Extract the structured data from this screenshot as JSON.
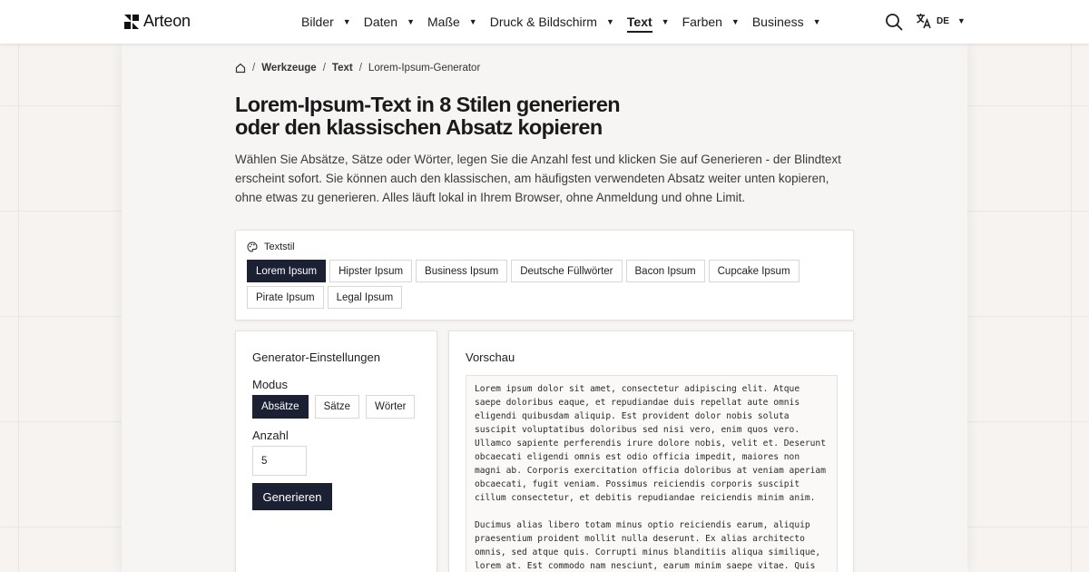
{
  "brand": {
    "name": "Arteon"
  },
  "nav": {
    "items": [
      {
        "label": "Bilder",
        "active": false
      },
      {
        "label": "Daten",
        "active": false
      },
      {
        "label": "Maße",
        "active": false
      },
      {
        "label": "Druck & Bildschirm",
        "active": false
      },
      {
        "label": "Text",
        "active": true
      },
      {
        "label": "Farben",
        "active": false
      },
      {
        "label": "Business",
        "active": false
      }
    ],
    "search_icon": "search-icon",
    "language": {
      "icon": "translate-icon",
      "code": "DE"
    }
  },
  "breadcrumb": {
    "home_icon": "home-icon",
    "items": [
      "Werkzeuge",
      "Text"
    ],
    "current": "Lorem-Ipsum-Generator"
  },
  "page": {
    "title_line1": "Lorem-Ipsum-Text in 8 Stilen generieren",
    "title_line2": "oder den klassischen Absatz kopieren",
    "intro": "Wählen Sie Absätze, Sätze oder Wörter, legen Sie die Anzahl fest und klicken Sie auf Generieren - der Blindtext erscheint sofort. Sie können auch den klassischen, am häufigsten verwendeten Absatz weiter unten kopieren, ohne etwas zu generieren. Alles läuft lokal in Ihrem Browser, ohne Anmeldung und ohne Limit."
  },
  "text_style": {
    "label": "Textstil",
    "icon": "palette-icon",
    "options": [
      "Lorem Ipsum",
      "Hipster Ipsum",
      "Business Ipsum",
      "Deutsche Füllwörter",
      "Bacon Ipsum",
      "Cupcake Ipsum",
      "Pirate Ipsum",
      "Legal Ipsum"
    ],
    "selected": "Lorem Ipsum"
  },
  "settings": {
    "title": "Generator-Einstellungen",
    "mode_label": "Modus",
    "modes": [
      "Absätze",
      "Sätze",
      "Wörter"
    ],
    "selected_mode": "Absätze",
    "count_label": "Anzahl",
    "count_value": "5",
    "generate_label": "Generieren"
  },
  "preview": {
    "title": "Vorschau",
    "paragraphs": [
      "Lorem ipsum dolor sit amet, consectetur adipiscing elit. Atque saepe doloribus eaque, et repudiandae duis repellat aute omnis eligendi quibusdam aliquip. Est provident dolor nobis soluta suscipit voluptatibus doloribus sed nisi vero, enim quos vero. Ullamco sapiente perferendis irure dolore nobis, velit et. Deserunt obcaecati eligendi omnis est odio officia impedit, maiores non magni ab. Corporis exercitation officia doloribus at veniam aperiam obcaecati, fugit veniam. Possimus reiciendis corporis suscipit cillum consectetur, et debitis repudiandae reiciendis minim anim.",
      "Ducimus alias libero totam minus optio reiciendis earum, aliquip praesentium proident mollit nulla deserunt. Ex alias architecto omnis, sed atque quis. Corrupti minus blanditiis aliqua similique, lorem at. Est commodo nam nesciunt, earum minim saepe vitae. Quis"
    ]
  }
}
